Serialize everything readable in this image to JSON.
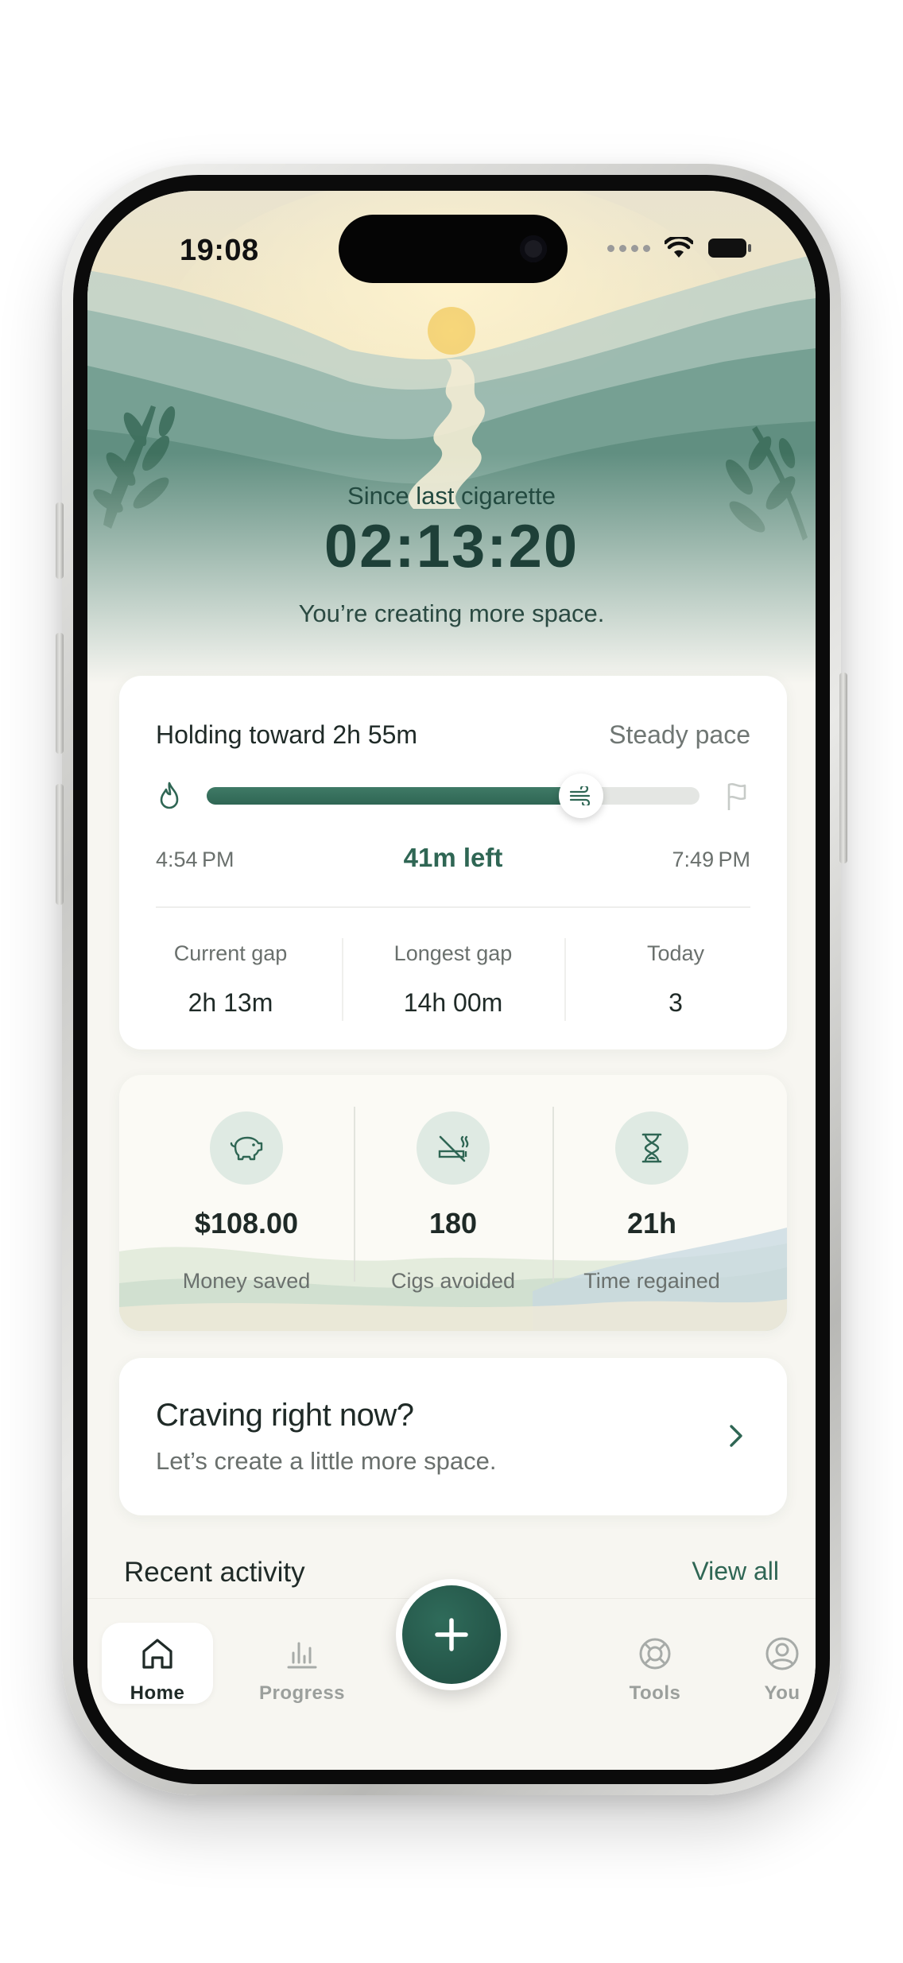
{
  "status_bar": {
    "time": "19:08"
  },
  "hero": {
    "label": "Since last cigarette",
    "timer": "02:13:20",
    "subtitle": "You’re creating more space."
  },
  "goal": {
    "title": "Holding toward 2h 55m",
    "pace": "Steady pace",
    "progress_fraction": 0.76,
    "start_time": "4:54 PM",
    "remaining": "41m left",
    "end_time": "7:49 PM",
    "stats": [
      {
        "label": "Current gap",
        "value": "2h 13m"
      },
      {
        "label": "Longest gap",
        "value": "14h 00m"
      },
      {
        "label": "Today",
        "value": "3"
      }
    ]
  },
  "savings": [
    {
      "icon": "piggy-bank-icon",
      "value": "$108.00",
      "label": "Money saved"
    },
    {
      "icon": "no-smoking-icon",
      "value": "180",
      "label": "Cigs avoided"
    },
    {
      "icon": "hourglass-icon",
      "value": "21h",
      "label": "Time regained"
    }
  ],
  "craving": {
    "title": "Craving right now?",
    "subtitle": "Let’s create a little more space."
  },
  "recent": {
    "title": "Recent activity",
    "view_all": "View all"
  },
  "tabs": [
    {
      "label": "Home",
      "icon": "home-icon",
      "active": true
    },
    {
      "label": "Progress",
      "icon": "bar-chart-icon",
      "active": false
    },
    {
      "label": "Tools",
      "icon": "lifebuoy-icon",
      "active": false
    },
    {
      "label": "You",
      "icon": "user-circle-icon",
      "active": false
    }
  ],
  "colors": {
    "accent": "#2f6654",
    "background": "#f7f6f1",
    "card": "#ffffff"
  }
}
